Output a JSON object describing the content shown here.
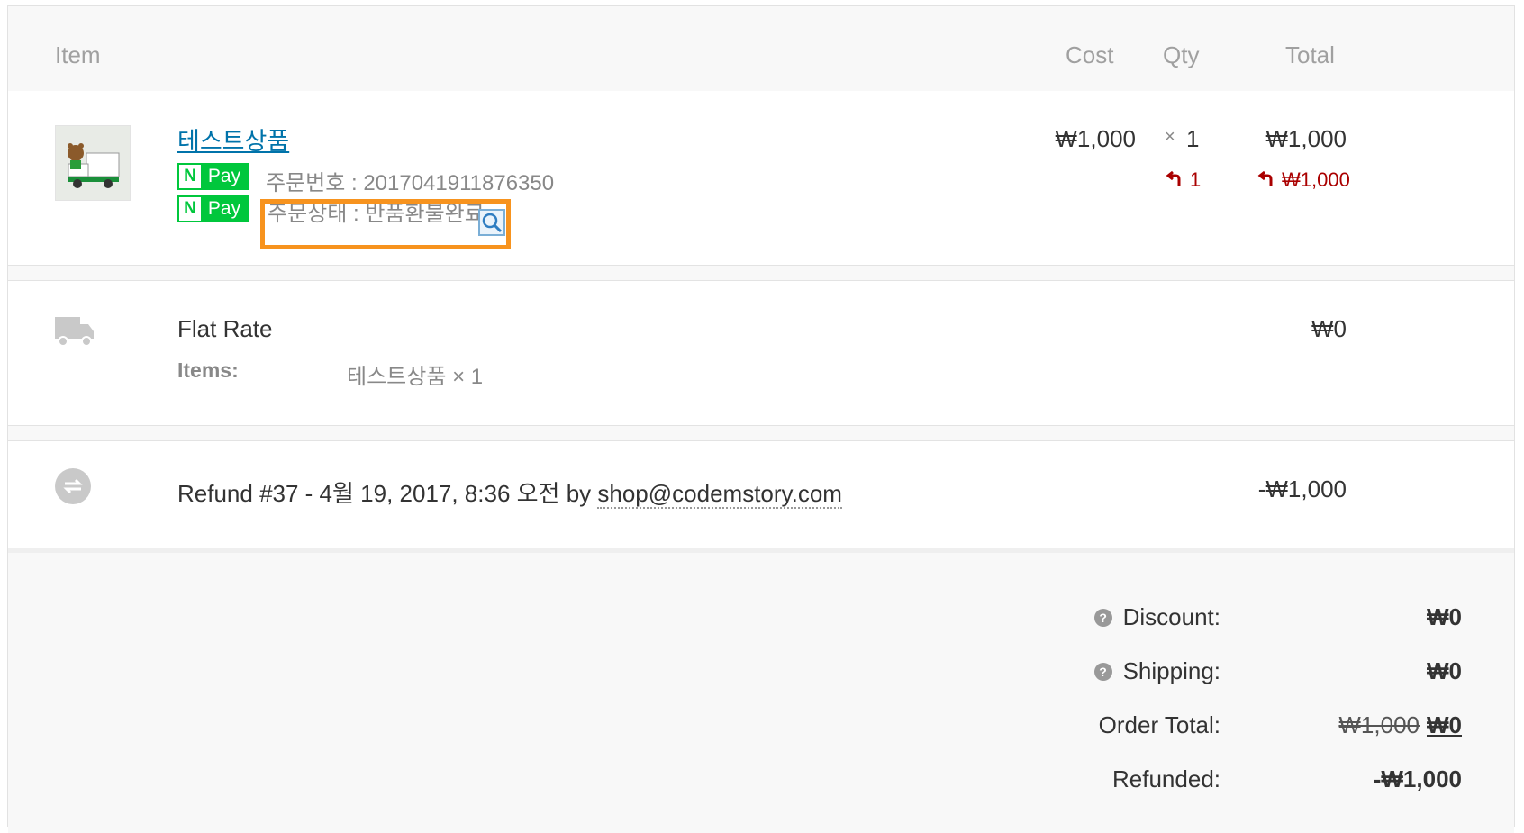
{
  "header": {
    "item": "Item",
    "cost": "Cost",
    "qty": "Qty",
    "total": "Total"
  },
  "line_item": {
    "name": "테스트상품",
    "pay_badge_n": "N",
    "pay_badge_label": "Pay",
    "order_number": "주문번호 : 2017041911876350",
    "order_status": "주문상태 : 반품환불완료",
    "cost": "₩1,000",
    "qty_prefix": "×",
    "qty": "1",
    "total": "₩1,000",
    "refund_qty": "1",
    "refund_total": "₩1,000",
    "refund_icon": "undo-arrow-icon"
  },
  "shipping": {
    "method": "Flat Rate",
    "items_label": "Items:",
    "items_value": "테스트상품 × 1",
    "total": "₩0",
    "icon": "truck-icon"
  },
  "refund_row": {
    "prefix": "Refund #37 - 4월 19, 2017, 8:36 오전 by ",
    "email": "shop@codemstory.com",
    "amount": "-₩1,000",
    "icon": "refund-icon"
  },
  "totals": {
    "discount_label": "Discount:",
    "discount_value": "₩0",
    "shipping_label": "Shipping:",
    "shipping_value": "₩0",
    "order_total_label": "Order Total:",
    "order_total_old": "₩1,000",
    "order_total_new": "₩0",
    "refunded_label": "Refunded:",
    "refunded_value": "-₩1,000",
    "help_icon": "?"
  },
  "colors": {
    "highlight": "#f7931e",
    "npay_green": "#00c73c",
    "refund_red": "#aa0000",
    "link_blue": "#0073aa"
  }
}
